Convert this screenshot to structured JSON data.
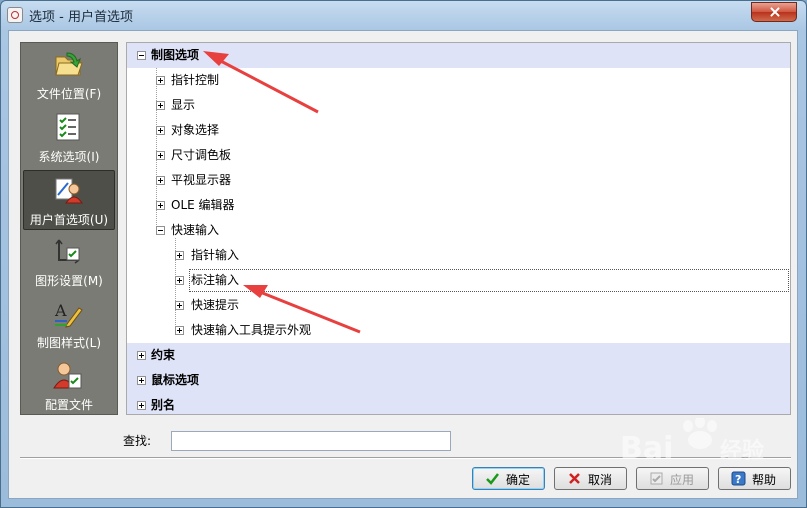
{
  "window": {
    "title": "选项 - 用户首选项"
  },
  "sidebar": {
    "items": [
      {
        "label": "文件位置(F)",
        "icon": "folder-open-icon"
      },
      {
        "label": "系统选项(I)",
        "icon": "checklist-icon"
      },
      {
        "label": "用户首选项(U)",
        "icon": "user-preferences-icon"
      },
      {
        "label": "图形设置(M)",
        "icon": "graphics-settings-icon"
      },
      {
        "label": "制图样式(L)",
        "icon": "drawing-style-icon"
      },
      {
        "label": "配置文件",
        "icon": "profile-icon"
      }
    ]
  },
  "tree": {
    "items": [
      {
        "label": "制图选项",
        "level": 0,
        "expanded": true
      },
      {
        "label": "指针控制",
        "level": 1,
        "expanded": false
      },
      {
        "label": "显示",
        "level": 1,
        "expanded": false
      },
      {
        "label": "对象选择",
        "level": 1,
        "expanded": false
      },
      {
        "label": "尺寸调色板",
        "level": 1,
        "expanded": false
      },
      {
        "label": "平视显示器",
        "level": 1,
        "expanded": false
      },
      {
        "label": "OLE 编辑器",
        "level": 1,
        "expanded": false
      },
      {
        "label": "快速输入",
        "level": 1,
        "expanded": true
      },
      {
        "label": "指针输入",
        "level": 2,
        "expanded": false
      },
      {
        "label": "标注输入",
        "level": 2,
        "expanded": false,
        "focused": true
      },
      {
        "label": "快速提示",
        "level": 2,
        "expanded": false
      },
      {
        "label": "快速输入工具提示外观",
        "level": 2,
        "expanded": false
      },
      {
        "label": "约束",
        "level": 0,
        "expanded": false
      },
      {
        "label": "鼠标选项",
        "level": 0,
        "expanded": false
      },
      {
        "label": "别名",
        "level": 0,
        "expanded": false
      }
    ]
  },
  "search": {
    "label": "查找:",
    "value": ""
  },
  "buttons": {
    "ok": "确定",
    "cancel": "取消",
    "apply": "应用",
    "help": "帮助"
  },
  "watermark": {
    "text": "Baidu 经验"
  },
  "colors": {
    "annotation_arrow": "#e8403f",
    "tree_top_level_bg": "#dfe3f8",
    "sidebar_bg": "#7b7b75"
  }
}
